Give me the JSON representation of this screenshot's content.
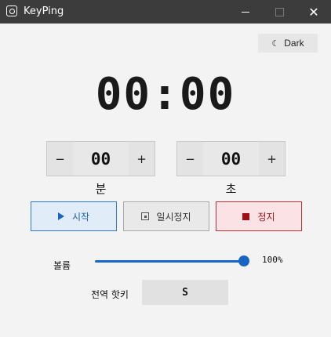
{
  "window": {
    "title": "KeyPing",
    "minimize_label": "",
    "maximize_label": "",
    "close_label": "✕"
  },
  "theme_toggle": {
    "icon": "moon-icon",
    "label": "Dark"
  },
  "timer": {
    "display": "00:00"
  },
  "minutes": {
    "value": "00",
    "dec_label": "−",
    "inc_label": "+",
    "unit": "분"
  },
  "seconds": {
    "value": "00",
    "dec_label": "−",
    "inc_label": "+",
    "unit": "초"
  },
  "controls": {
    "start": {
      "label": "시작",
      "color": "#1766c4"
    },
    "pause": {
      "label": "일시정지"
    },
    "stop": {
      "label": "정지",
      "color": "#a30d15"
    }
  },
  "volume": {
    "label": "볼륨",
    "value": 100,
    "display": "100%"
  },
  "hotkey": {
    "label": "전역 핫키",
    "value": "S"
  }
}
